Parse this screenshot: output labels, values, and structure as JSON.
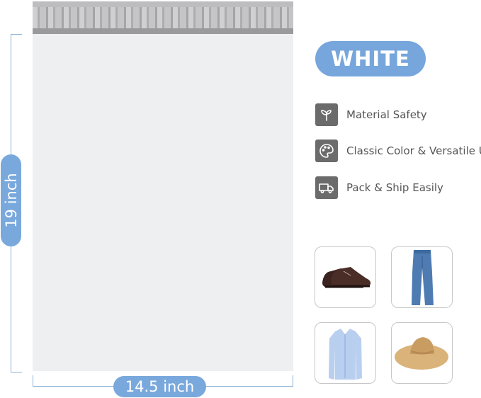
{
  "product": {
    "color_label": "WHITE",
    "dimensions": {
      "height_label": "19 inch",
      "width_label": "14.5 inch"
    }
  },
  "features": [
    {
      "icon": "sprout-icon",
      "label": "Material Safety"
    },
    {
      "icon": "palette-icon",
      "label": "Classic Color & Versatile Use"
    },
    {
      "icon": "truck-icon",
      "label": "Pack & Ship Easily"
    }
  ],
  "thumbnails": [
    {
      "icon": "shoes-icon"
    },
    {
      "icon": "jeans-icon"
    },
    {
      "icon": "shirt-icon"
    },
    {
      "icon": "sun-hat-icon"
    }
  ]
}
